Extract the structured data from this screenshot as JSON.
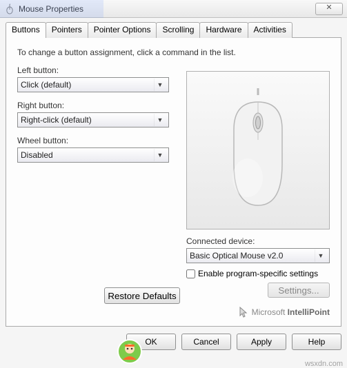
{
  "window": {
    "title": "Mouse Properties",
    "close_glyph": "✕"
  },
  "tabs": [
    "Buttons",
    "Pointers",
    "Pointer Options",
    "Scrolling",
    "Hardware",
    "Activities"
  ],
  "panel": {
    "instruction": "To change a button assignment, click a command in the list.",
    "left_button_label": "Left button:",
    "left_button_value": "Click (default)",
    "right_button_label": "Right button:",
    "right_button_value": "Right-click (default)",
    "wheel_button_label": "Wheel button:",
    "wheel_button_value": "Disabled",
    "connected_label": "Connected device:",
    "connected_value": "Basic Optical Mouse v2.0",
    "enable_specific_label": "Enable program-specific settings",
    "settings_button": "Settings...",
    "restore_button": "Restore Defaults",
    "brand_prefix": "Microsoft ",
    "brand_strong": "IntelliPoint"
  },
  "buttons": {
    "ok": "OK",
    "cancel": "Cancel",
    "apply": "Apply",
    "help": "Help"
  },
  "watermark": "wsxdn.com"
}
